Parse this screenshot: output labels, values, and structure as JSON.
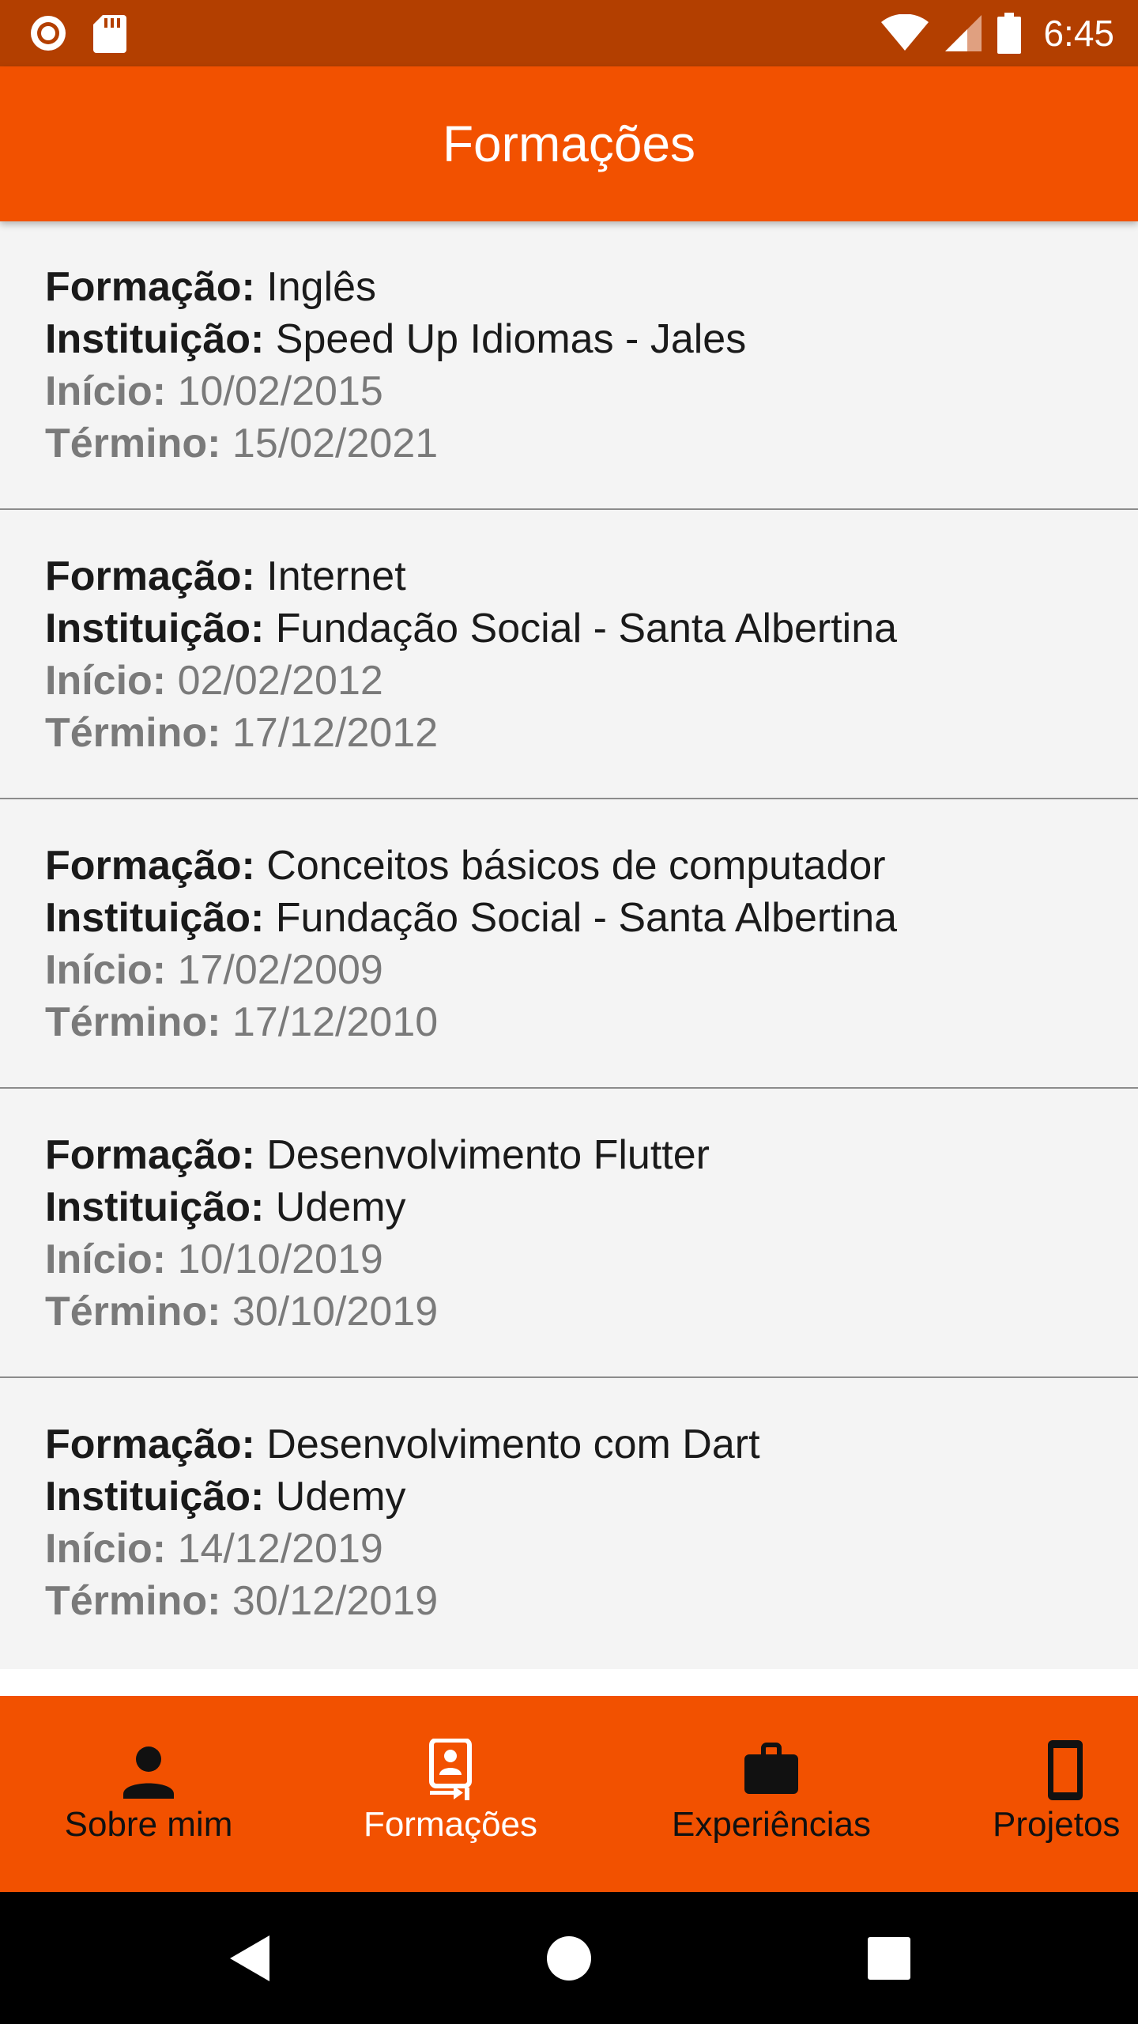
{
  "status_bar": {
    "time": "6:45",
    "icons": [
      "record-icon",
      "sd-card-icon",
      "wifi-icon",
      "signal-icon",
      "battery-icon"
    ]
  },
  "app_bar": {
    "title": "Formações"
  },
  "labels": {
    "formacao": "Formação:",
    "instituicao": "Instituição:",
    "inicio": "Início:",
    "termino": "Término:"
  },
  "items": [
    {
      "formacao": "Inglês",
      "instituicao": "Speed Up Idiomas - Jales",
      "inicio": "10/02/2015",
      "termino": "15/02/2021"
    },
    {
      "formacao": "Internet",
      "instituicao": "Fundação Social - Santa Albertina",
      "inicio": "02/02/2012",
      "termino": "17/12/2012"
    },
    {
      "formacao": "Conceitos básicos de computador",
      "instituicao": "Fundação Social - Santa Albertina",
      "inicio": "17/02/2009",
      "termino": "17/12/2010"
    },
    {
      "formacao": "Desenvolvimento Flutter",
      "instituicao": "Udemy",
      "inicio": "10/10/2019",
      "termino": "30/10/2019"
    },
    {
      "formacao": "Desenvolvimento com Dart",
      "instituicao": "Udemy",
      "inicio": "14/12/2019",
      "termino": "30/12/2019"
    }
  ],
  "bottom_nav": {
    "items": [
      {
        "label": "Sobre mim",
        "icon": "person-icon",
        "active": false
      },
      {
        "label": "Formações",
        "icon": "badge-icon",
        "active": true
      },
      {
        "label": "Experiências",
        "icon": "briefcase-icon",
        "active": false
      },
      {
        "label": "Projetos",
        "icon": "smartphone-icon",
        "active": false
      }
    ]
  },
  "system_nav": {
    "icons": [
      "back-icon",
      "home-icon",
      "recents-icon"
    ]
  },
  "colors": {
    "status_bar": "#b33f00",
    "primary": "#f25100",
    "list_background": "#f4f4f4",
    "active_nav": "#ffffff",
    "inactive_nav": "#111111"
  }
}
